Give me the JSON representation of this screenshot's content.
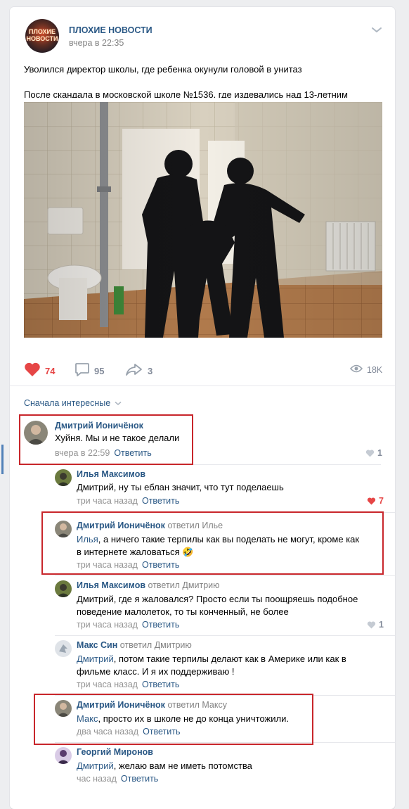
{
  "post": {
    "group_name": "ПЛОХИЕ НОВОСТИ",
    "avatar_text_1": "ПЛОХИЕ",
    "avatar_text_2": "НОВОСТИ",
    "time": "вчера в 22:35",
    "text_line1": "Уволился директор школы, где ребенка окунули головой в унитаз",
    "text_line2": "После скандала в московской школе №1536, где издевались над 13-летним",
    "likes": "74",
    "comments": "95",
    "shares": "3",
    "views": "18K",
    "icons": [
      "heart-icon",
      "comment-icon",
      "share-icon",
      "eye-icon",
      "chevron-down-icon"
    ],
    "accent_color": "#2a5885",
    "like_color": "#e64646"
  },
  "comments_sort": "Сначала интересные",
  "reply_label": "Ответить",
  "comments": [
    {
      "author": "Дмитрий Ионичёнок",
      "reply_to": "",
      "mention": "",
      "text": "Хуйня. Мы и не такое делали",
      "time": "вчера в 22:59",
      "likes": "1"
    },
    {
      "author": "Илья Максимов",
      "reply_to": "",
      "mention": "",
      "text": "Дмитрий, ну ты еблан значит, что тут поделаешь",
      "time": "три часа назад",
      "likes": "7"
    },
    {
      "author": "Дмитрий Ионичёнок",
      "reply_to": "ответил Илье",
      "mention": "Илья",
      "text": ", а ничего такие терпилы как вы поделать не могут, кроме как в интернете жаловаться 🤣",
      "time": "три часа назад",
      "likes": ""
    },
    {
      "author": "Илья Максимов",
      "reply_to": "ответил Дмитрию",
      "mention": "",
      "text": "Дмитрий, где я жаловался? Просто если ты поощряешь подобное поведение малолеток, то ты конченный, не более",
      "time": "три часа назад",
      "likes": "1"
    },
    {
      "author": "Макс Син",
      "reply_to": "ответил Дмитрию",
      "mention": "Дмитрий",
      "text": ", потом такие терпилы делают как в Америке или как в фильме класс. И я их поддерживаю !",
      "time": "три часа назад",
      "likes": ""
    },
    {
      "author": "Дмитрий Ионичёнок",
      "reply_to": "ответил Максу",
      "mention": "Макс",
      "text": ", просто их в школе не до конца уничтожили.",
      "time": "два часа назад",
      "likes": ""
    },
    {
      "author": "Георгий Миронов",
      "reply_to": "",
      "mention": "Дмитрий",
      "text": ", желаю вам не иметь потомства",
      "time": "час назад",
      "likes": ""
    }
  ]
}
